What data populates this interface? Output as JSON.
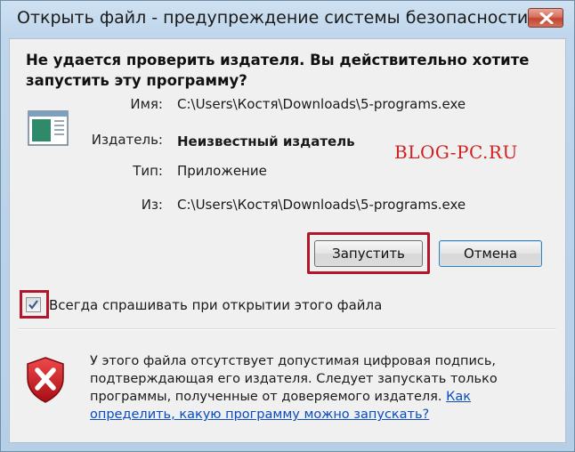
{
  "window": {
    "title": "Открыть файл - предупреждение системы безопасности"
  },
  "dialog": {
    "heading": "Не удается проверить издателя.  Вы действительно хотите запустить эту программу?",
    "fields": [
      {
        "label": "Имя:",
        "value": "C:\\Users\\Костя\\Downloads\\5-programs.exe"
      },
      {
        "label": "Издатель:",
        "value": "Неизвестный издатель"
      },
      {
        "label": "Тип:",
        "value": "Приложение"
      },
      {
        "label": "Из:",
        "value": "C:\\Users\\Костя\\Downloads\\5-programs.exe"
      }
    ],
    "watermark": "BLOG-PC.RU",
    "buttons": {
      "run": "Запустить",
      "cancel": "Отмена"
    },
    "checkbox": {
      "label": "Всегда спрашивать при открытии этого файла",
      "checked": true
    },
    "warning": {
      "text": "У этого файла отсутствует допустимая цифровая подпись, подтверждающая его издателя.  Следует запускать только программы, полученные от доверяемого издателя. ",
      "link": "Как определить, какую программу можно запускать?"
    }
  },
  "icons": {
    "close": "close-icon",
    "app": "application-icon",
    "shield": "security-shield-icon",
    "check": "checkmark-icon"
  },
  "colors": {
    "highlight": "#b3162b",
    "watermark": "#d02020",
    "link": "#0a4cc2",
    "shield": "#c8151d"
  }
}
